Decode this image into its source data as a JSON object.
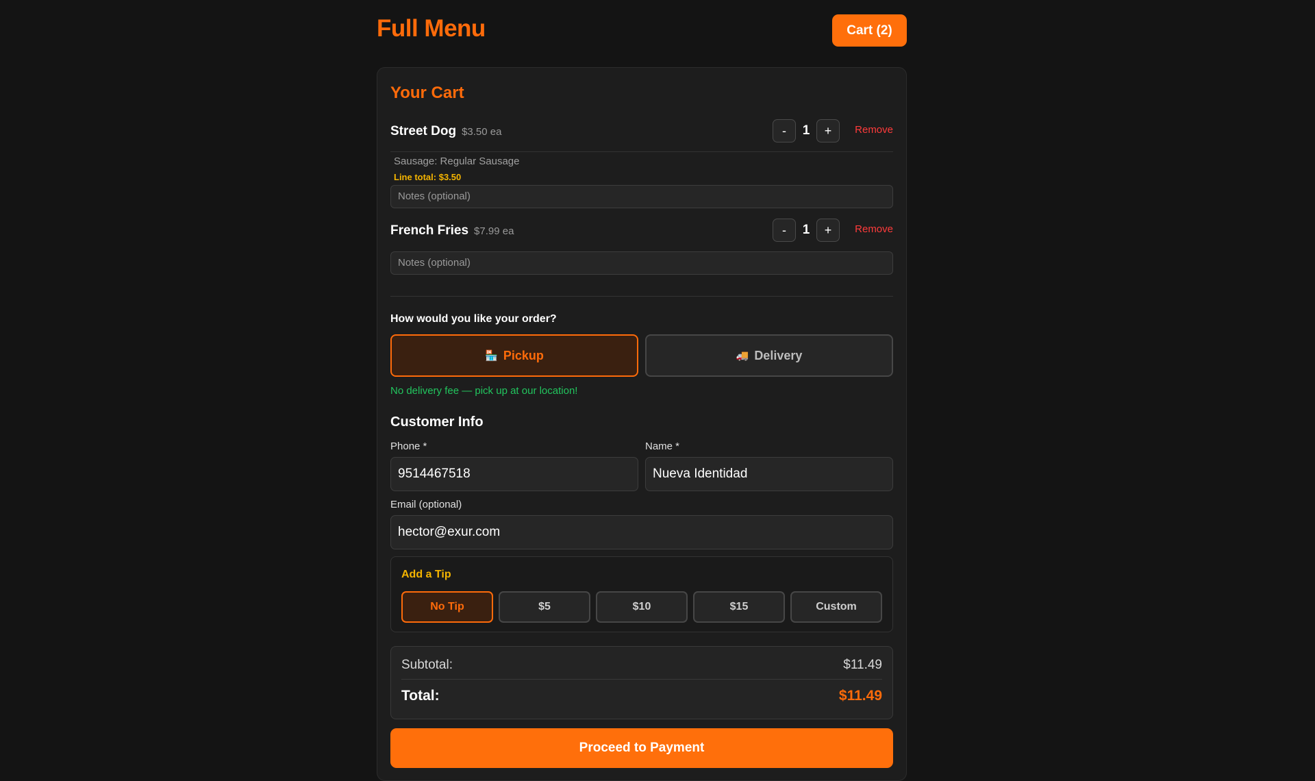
{
  "header": {
    "brand": "Full Menu",
    "cart_button": "Cart (2)"
  },
  "cart": {
    "title": "Your Cart",
    "items": [
      {
        "name": "Street Dog",
        "price": "$3.50 ea",
        "qty": "1",
        "dec": "-",
        "inc": "+",
        "remove": "Remove",
        "option": "Sausage: Regular Sausage",
        "line_total": "Line total: $3.50",
        "notes_placeholder": "Notes (optional)"
      },
      {
        "name": "French Fries",
        "price": "$7.99 ea",
        "qty": "1",
        "dec": "-",
        "inc": "+",
        "remove": "Remove",
        "notes_placeholder": "Notes (optional)"
      }
    ]
  },
  "order_type": {
    "question": "How would you like your order?",
    "pickup": {
      "icon": "store-icon",
      "glyph": "🏪",
      "label": "Pickup",
      "selected": true
    },
    "delivery": {
      "icon": "truck-icon",
      "glyph": "🚚",
      "label": "Delivery",
      "selected": false
    },
    "note": "No delivery fee — pick up at our location!"
  },
  "customer": {
    "title": "Customer Info",
    "phone_label": "Phone *",
    "phone_value": "9514467518",
    "name_label": "Name *",
    "name_value": "Nueva Identidad",
    "email_label": "Email (optional)",
    "email_value": "hector@exur.com"
  },
  "tip": {
    "title": "Add a Tip",
    "options": [
      "No Tip",
      "$5",
      "$10",
      "$15",
      "Custom"
    ],
    "selected": "No Tip"
  },
  "totals": {
    "subtotal_label": "Subtotal:",
    "subtotal_value": "$11.49",
    "total_label": "Total:",
    "total_value": "$11.49"
  },
  "pay_button": "Proceed to Payment",
  "colors": {
    "accent": "#ff6b0a",
    "danger": "#ff3b3b",
    "success": "#22c55e",
    "highlight": "#f4b400",
    "background": "#141414"
  }
}
